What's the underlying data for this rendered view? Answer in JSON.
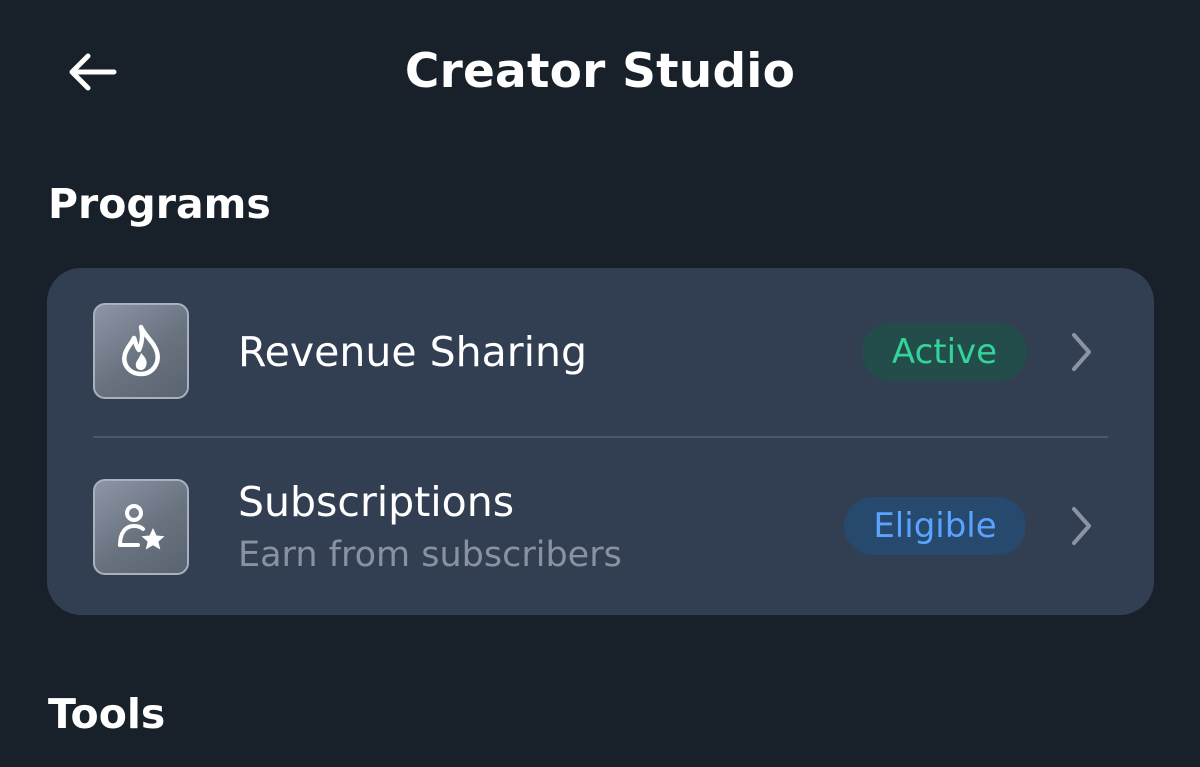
{
  "header": {
    "back_icon": "arrow-left-icon",
    "title": "Creator Studio"
  },
  "sections": {
    "programs_heading": "Programs",
    "tools_heading": "Tools"
  },
  "programs": [
    {
      "icon": "flame-icon",
      "title": "Revenue Sharing",
      "subtitle": "",
      "status": "Active",
      "status_color": "#34d39a",
      "status_bg": "#234d4a"
    },
    {
      "icon": "person-star-icon",
      "title": "Subscriptions",
      "subtitle": "Earn from subscribers",
      "status": "Eligible",
      "status_color": "#5aa4ff",
      "status_bg": "#27496e"
    }
  ],
  "colors": {
    "background": "#18202a",
    "card": "#323f52",
    "subtitle_text": "#8892a2"
  }
}
